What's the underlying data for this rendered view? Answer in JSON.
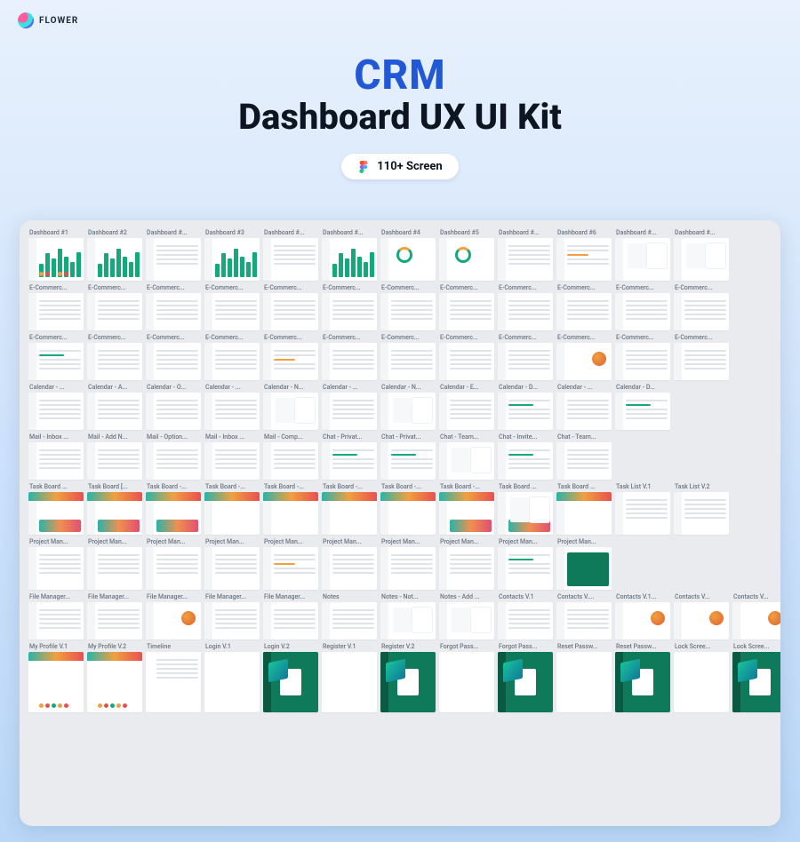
{
  "brand": {
    "name": "FLOWER"
  },
  "hero": {
    "title": "CRM",
    "subtitle": "Dashboard UX UI Kit",
    "pill": "110+ Screen"
  },
  "rows": [
    {
      "h": "th-md",
      "cells": [
        "Dashboard #1",
        "Dashboard #2",
        "Dashboard #...",
        "Dashboard #3",
        "Dashboard #...",
        "Dashboard #...",
        "Dashboard #4",
        "Dashboard #5",
        "Dashboard #...",
        "Dashboard #6",
        "Dashboard #...",
        "Dashboard #..."
      ],
      "styles": [
        "bars dots",
        "bars",
        "lines",
        "bars a",
        "lines",
        "bars",
        "ring",
        "ring",
        "lines",
        "lines o",
        "cards blob",
        "cards blob"
      ]
    },
    {
      "h": "th-sm",
      "cells": [
        "E-Commerc...",
        "E-Commerc...",
        "E-Commerc...",
        "E-Commerc...",
        "E-Commerc...",
        "E-Commerc...",
        "E-Commerc...",
        "E-Commerc...",
        "E-Commerc...",
        "E-Commerc...",
        "E-Commerc...",
        "E-Commerc..."
      ],
      "styles": [
        "lines",
        "lines",
        "lines",
        "lines",
        "lines",
        "lines",
        "lines",
        "lines",
        "lines",
        "lines",
        "lines",
        "lines"
      ]
    },
    {
      "h": "th-sm",
      "cells": [
        "E-Commerc...",
        "E-Commerc...",
        "E-Commerc...",
        "E-Commerc...",
        "E-Commerc...",
        "E-Commerc...",
        "E-Commerc...",
        "E-Commerc...",
        "E-Commerc...",
        "E-Commerc...",
        "E-Commerc...",
        "E-Commerc..."
      ],
      "styles": [
        "lines a",
        "lines",
        "lines",
        "lines",
        "lines o",
        "lines",
        "lines",
        "lines",
        "lines",
        "blob",
        "lines",
        "lines"
      ]
    },
    {
      "h": "th-sm",
      "cells": [
        "Calendar - ...",
        "Calendar - A...",
        "Calendar - O...",
        "Calendar - ...",
        "Calendar - N...",
        "Calendar - ...",
        "Calendar - N...",
        "Calendar - E...",
        "Calendar - D...",
        "Calendar - ...",
        "Calendar - D...",
        ""
      ],
      "styles": [
        "lines",
        "lines",
        "lines",
        "lines",
        "cards",
        "lines",
        "cards",
        "lines",
        "lines a",
        "lines",
        "lines a",
        "blank"
      ]
    },
    {
      "h": "th-sm",
      "cells": [
        "Mail - Inbox ...",
        "Mail - Add N...",
        "Mail - Option...",
        "Mail - Inbox ...",
        "Mail - Comp...",
        "Chat - Privat...",
        "Chat - Privat...",
        "Chat - Team...",
        "Chat - Invite...",
        "Chat - Team...",
        "",
        ""
      ],
      "styles": [
        "lines",
        "lines",
        "lines",
        "lines",
        "lines",
        "lines a",
        "lines a",
        "cards",
        "lines a",
        "lines",
        "blank",
        "blank"
      ]
    },
    {
      "h": "th-md",
      "cells": [
        "Task Board ...",
        "Task Board [...",
        "Task Board -...",
        "Task Board -...",
        "Task Board -...",
        "Task Board -...",
        "Task Board -...",
        "Task Board -...",
        "Task Board ...",
        "Task Board ...",
        "Task List V.1",
        "Task List V.2"
      ],
      "styles": [
        "strip grad",
        "strip grad",
        "strip grad",
        "strip",
        "strip",
        "strip",
        "strip",
        "strip grad",
        "grad cards",
        "strip",
        "lines",
        "lines"
      ]
    },
    {
      "h": "th-md",
      "cells": [
        "Project Man...",
        "Project Man...",
        "Project Man...",
        "Project Man...",
        "Project Man...",
        "Project Man...",
        "Project Man...",
        "Project Man...",
        "Project Man...",
        "Project Man...",
        "",
        ""
      ],
      "styles": [
        "lines",
        "lines",
        "lines",
        "lines",
        "lines o",
        "lines",
        "lines",
        "lines",
        "lines a",
        "panel-g",
        "blank",
        "blank"
      ]
    },
    {
      "h": "th-sm",
      "cells": [
        "File Manager...",
        "File Manager...",
        "File Manager...",
        "File Manager...",
        "File Manager...",
        "Notes",
        "Notes - Not...",
        "Notes - Add ...",
        "Contacts V.1",
        "Contacts V....",
        "Contacts V.1...",
        "Contacts V...",
        "Contacts V..."
      ],
      "styles": [
        "lines",
        "lines",
        "blob",
        "lines",
        "lines",
        "lines",
        "cards",
        "cards",
        "lines",
        "lines",
        "blob",
        "blob",
        "blob"
      ]
    },
    {
      "h": "th-xl",
      "cells": [
        "My Profile V.1",
        "My Profile V.2",
        "Timeline",
        "Login V.1",
        "Login V.2",
        "Register V.1",
        "Register V.2",
        "Forgot Pass...",
        "Forgot Pass...",
        "Reset Passw...",
        "Reset Passw...",
        "Lock Scree...",
        "Lock Scree..."
      ],
      "styles": [
        "strip dots noside",
        "strip dots noside",
        "lines noside",
        "auth noside",
        "dark iso auth",
        "auth noside",
        "dark iso auth",
        "auth noside",
        "dark iso auth",
        "auth noside",
        "dark iso auth",
        "auth noside",
        "dark iso auth"
      ]
    }
  ]
}
